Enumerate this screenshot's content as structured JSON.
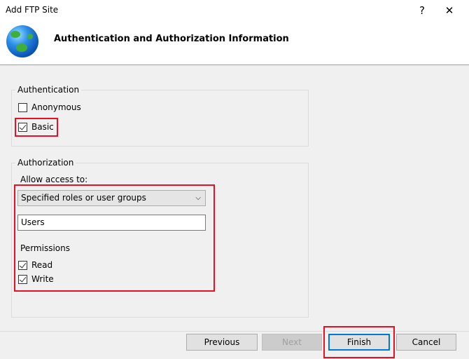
{
  "window": {
    "title": "Add FTP Site",
    "help_icon": "?",
    "close_icon": "✕"
  },
  "header": {
    "title": "Authentication and Authorization Information",
    "icon": "globe-icon"
  },
  "authentication": {
    "legend": "Authentication",
    "anonymous": {
      "label": "Anonymous",
      "checked": false
    },
    "basic": {
      "label": "Basic",
      "checked": true
    }
  },
  "authorization": {
    "legend": "Authorization",
    "allow_label": "Allow access to:",
    "allow_value": "Specified roles or user groups",
    "users_value": "Users",
    "permissions_label": "Permissions",
    "read": {
      "label": "Read",
      "checked": true
    },
    "write": {
      "label": "Write",
      "checked": true
    }
  },
  "footer": {
    "previous": "Previous",
    "next": "Next",
    "finish": "Finish",
    "cancel": "Cancel"
  },
  "colors": {
    "highlight": "#e81123",
    "focus": "#0078d7"
  }
}
